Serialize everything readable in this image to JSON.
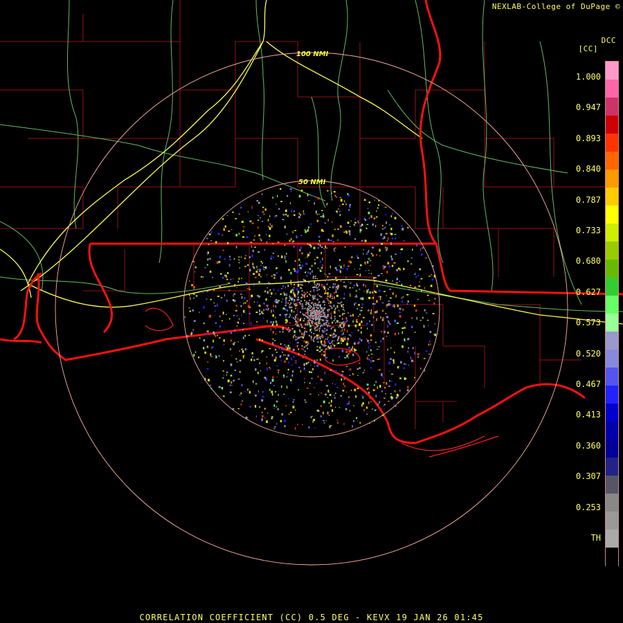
{
  "credit": "NEXLAB-College of DuPage ©",
  "product_code": "DCC",
  "units": "[CC]",
  "footer": "CORRELATION COEFFICIENT (CC) 0.5 DEG - KEVX 19 JAN 26 01:45",
  "range_rings": {
    "inner": "50 NMI",
    "outer": "100 NMI"
  },
  "scale": {
    "ticks": [
      "1.000",
      "0.947",
      "0.893",
      "0.840",
      "0.787",
      "0.733",
      "0.680",
      "0.627",
      "0.573",
      "0.520",
      "0.467",
      "0.413",
      "0.360",
      "0.307",
      "0.253",
      "TH"
    ],
    "colors": [
      "#ff99cc",
      "#ff66aa",
      "#cc3366",
      "#cc0000",
      "#ff3300",
      "#ff6600",
      "#ff9900",
      "#ffcc00",
      "#ffff00",
      "#ccee00",
      "#99cc00",
      "#66bb00",
      "#33cc33",
      "#66ff66",
      "#99ff99",
      "#9999cc",
      "#8888dd",
      "#5555ee",
      "#2222ff",
      "#0000cc",
      "#0000aa",
      "#000099",
      "#222288",
      "#555566",
      "#888888",
      "#999999",
      "#aaaaaa",
      "#000000"
    ]
  },
  "colors": {
    "state_border": "#ff1111",
    "county_line": "#bb1111",
    "highway": "#ffff66",
    "road": "#88ee88",
    "ring": "#ffb0a0",
    "text": "#ffff66"
  }
}
